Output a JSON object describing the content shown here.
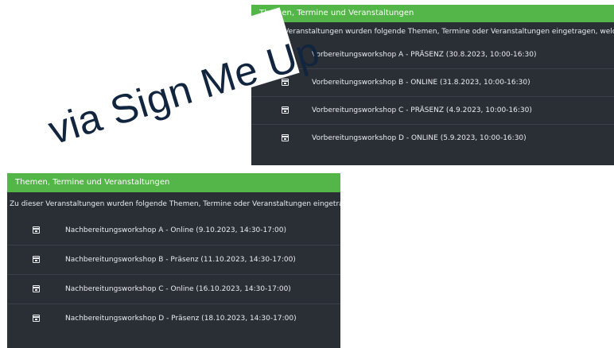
{
  "top_panel": {
    "header": "Themen, Termine und Veranstaltungen",
    "intro": "Zu dieser Veranstaltungen wurden folgende Themen, Termine oder Veranstaltungen eingetragen, welche",
    "items": [
      {
        "label": "Vorbereitungsworkshop A - PRÄSENZ (30.8.2023, 10:00-16:30)",
        "icon": "calendar-icon"
      },
      {
        "label": "Vorbereitungsworkshop B - ONLINE (31.8.2023, 10:00-16:30)",
        "icon": "calendar-icon"
      },
      {
        "label": "Vorbereitungsworkshop C - PRÄSENZ (4.9.2023, 10:00-16:30)",
        "icon": "calendar-icon"
      },
      {
        "label": "Vorbereitungsworkshop D - ONLINE (5.9.2023, 10:00-16:30)",
        "icon": "calendar-icon"
      }
    ]
  },
  "bottom_panel": {
    "header": "Themen, Termine und Veranstaltungen",
    "intro": "Zu dieser Veranstaltungen wurden folgende Themen, Termine oder Veranstaltungen eingetragen",
    "items": [
      {
        "label": "Nachbereitungsworkshop A - Online (9.10.2023, 14:30-17:00)",
        "icon": "calendar-icon"
      },
      {
        "label": "Nachbereitungsworkshop B - Präsenz (11.10.2023, 14:30-17:00)",
        "icon": "calendar-icon"
      },
      {
        "label": "Nachbereitungsworkshop C - Online (16.10.2023, 14:30-17:00)",
        "icon": "calendar-icon"
      },
      {
        "label": "Nachbereitungsworkshop D - Präsenz (18.10.2023, 14:30-17:00)",
        "icon": "calendar-icon"
      }
    ]
  },
  "banner": {
    "text": "via Sign Me Up"
  },
  "colors": {
    "panel_bg": "#2a2f36",
    "header_green": "#54b648",
    "banner_text": "#12253f"
  }
}
